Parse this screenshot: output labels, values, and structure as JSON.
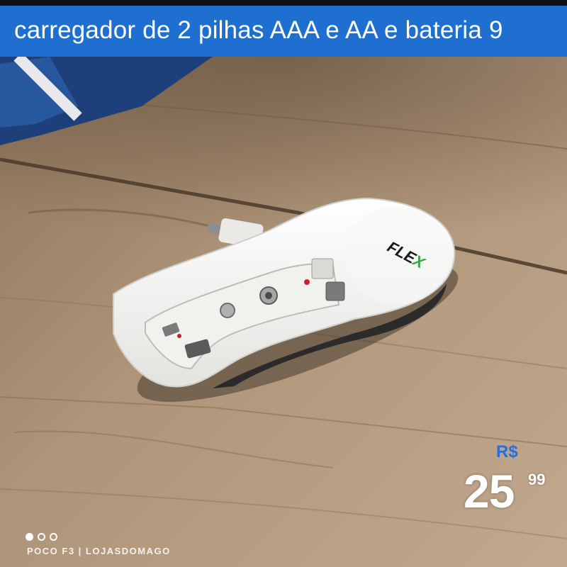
{
  "listing": {
    "title": "carregador de 2 pilhas AAA e AA e bateria 9"
  },
  "photo": {
    "subject": "charger-photo",
    "brand_logo_text": "FLEX"
  },
  "price": {
    "currency": "R$",
    "integer": "25",
    "cents": "99"
  },
  "carousel": {
    "dot_count": 3,
    "active_index": 0
  },
  "watermark": {
    "text": "POCO F3 | LOJASDOMAGO"
  },
  "colors": {
    "title_bar": "#1e6fd0",
    "currency": "#2a6fd8",
    "price_text": "#ffffff",
    "wood": "#a68c70"
  }
}
